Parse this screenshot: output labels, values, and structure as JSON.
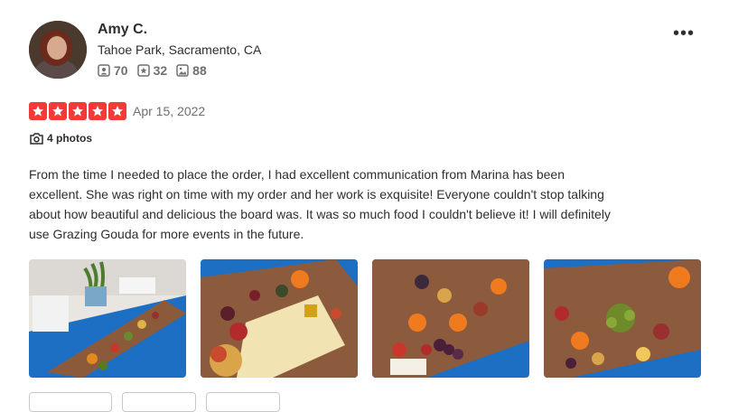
{
  "user": {
    "name": "Amy C.",
    "location": "Tahoe Park, Sacramento, CA",
    "stats": [
      {
        "icon": "friends-icon",
        "value": "70"
      },
      {
        "icon": "reviews-icon",
        "value": "32"
      },
      {
        "icon": "photos-icon",
        "value": "88"
      }
    ]
  },
  "review": {
    "rating": 5,
    "rating_color": "#f43939",
    "date": "Apr 15, 2022",
    "photos_label": "4 photos",
    "text": "From the time I needed to place the order, I had excellent communication from Marina has been excellent. She was right on time with my order and her work is exquisite! Everyone couldn't stop talking about how beautiful and delicious the board was. It was so much food I couldn't believe it! I will definitely use Grazing Gouda for more events in the future."
  },
  "colors": {
    "tablecloth_blue": "#1d6fc4",
    "text": "#2d2e2f",
    "muted": "#6e7072"
  }
}
